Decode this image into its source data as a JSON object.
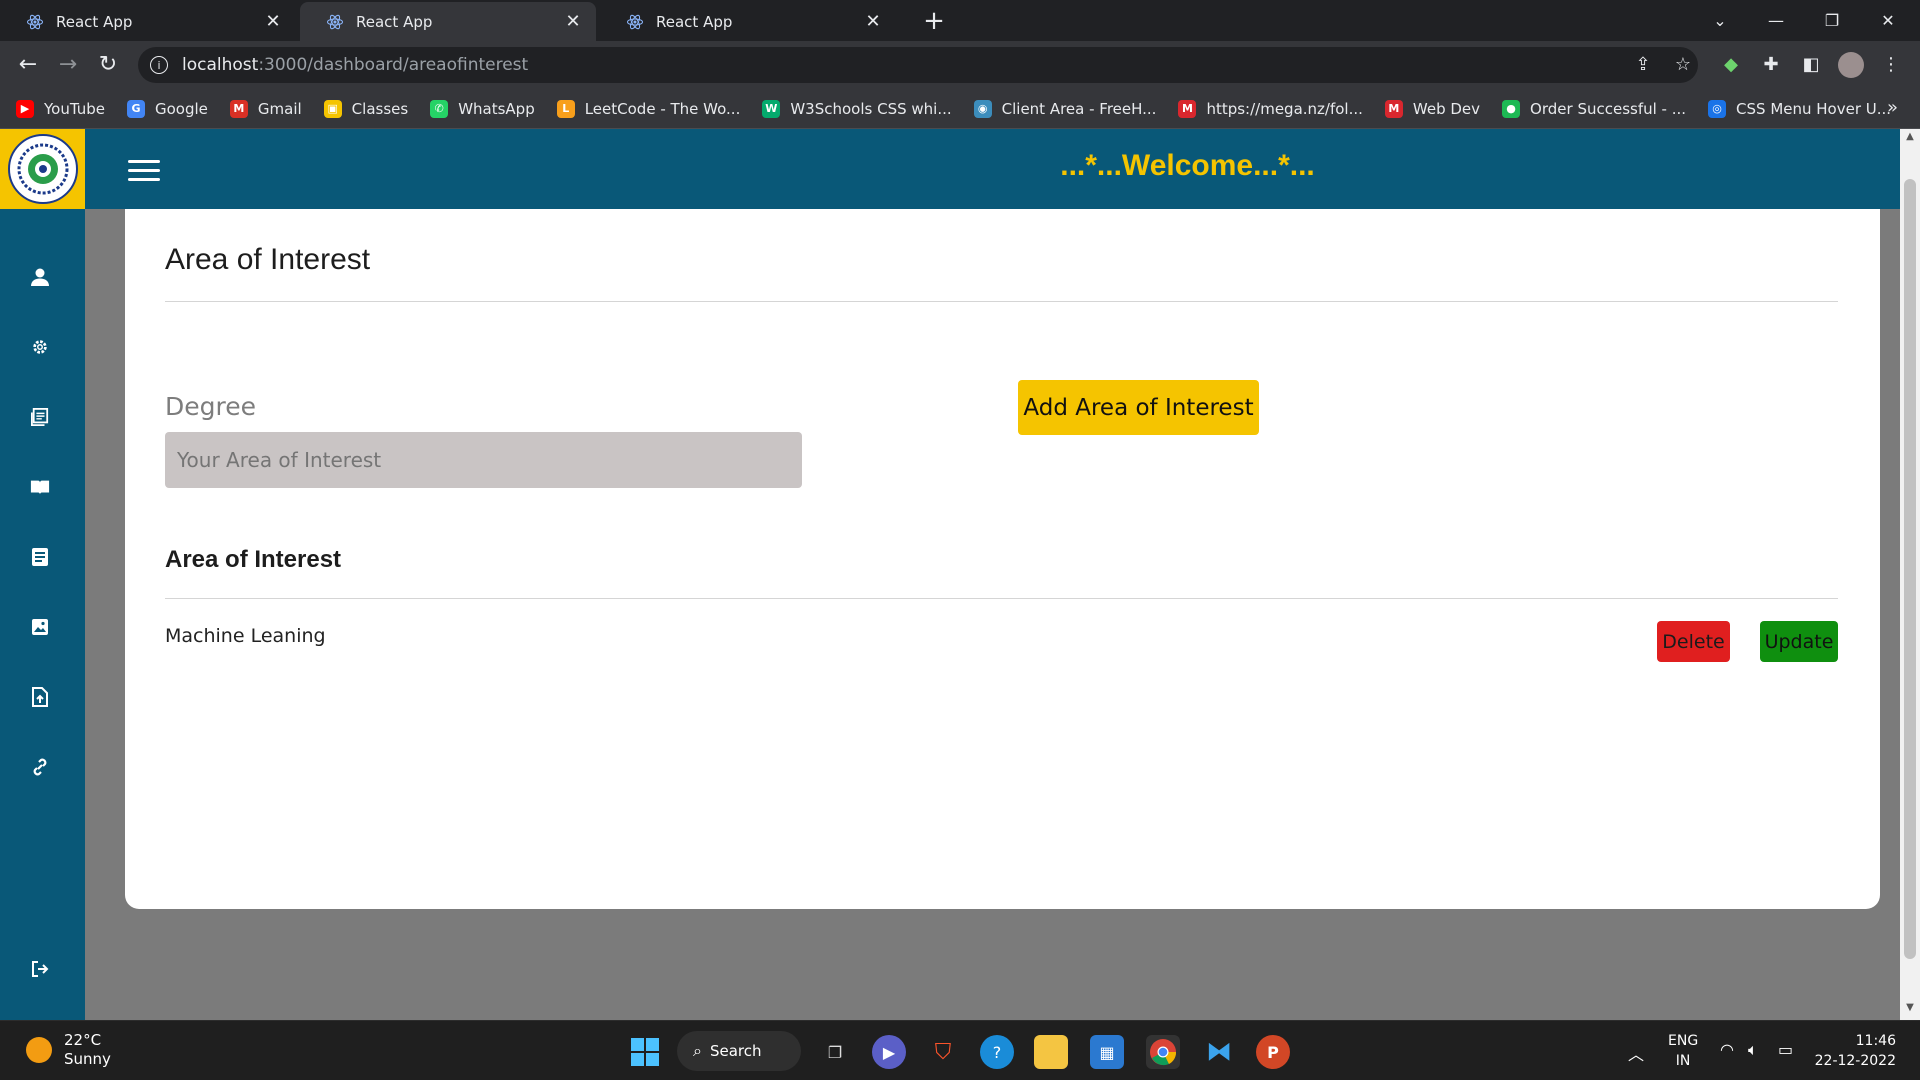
{
  "browser": {
    "tabs": [
      {
        "title": "React App",
        "active": false
      },
      {
        "title": "React App",
        "active": true
      },
      {
        "title": "React App",
        "active": false
      }
    ],
    "url_host": "localhost",
    "url_path": ":3000/dashboard/areaofinterest",
    "bookmarks": [
      {
        "label": "YouTube",
        "icon": "youtube-icon",
        "color": "#ff0000",
        "glyph": "▶"
      },
      {
        "label": "Google",
        "icon": "google-icon",
        "color": "#4285f4",
        "glyph": "G"
      },
      {
        "label": "Gmail",
        "icon": "gmail-icon",
        "color": "#d93025",
        "glyph": "M"
      },
      {
        "label": "Classes",
        "icon": "classes-icon",
        "color": "#f5c400",
        "glyph": "▣"
      },
      {
        "label": "WhatsApp",
        "icon": "whatsapp-icon",
        "color": "#25d366",
        "glyph": "✆"
      },
      {
        "label": "LeetCode - The Wo...",
        "icon": "leetcode-icon",
        "color": "#f89f1b",
        "glyph": "L"
      },
      {
        "label": "W3Schools CSS whi...",
        "icon": "w3schools-icon",
        "color": "#04aa6d",
        "glyph": "W"
      },
      {
        "label": "Client Area - FreeH...",
        "icon": "freehosting-icon",
        "color": "#3c8dbc",
        "glyph": "◉"
      },
      {
        "label": "https://mega.nz/fol...",
        "icon": "mega-icon",
        "color": "#d9272e",
        "glyph": "M"
      },
      {
        "label": "Web Dev",
        "icon": "mega-icon",
        "color": "#d9272e",
        "glyph": "M"
      },
      {
        "label": "Order Successful - ...",
        "icon": "status-dot-icon",
        "color": "#1db954",
        "glyph": "●"
      },
      {
        "label": "CSS Menu Hover U...",
        "icon": "bookmark-page-icon",
        "color": "#1a73e8",
        "glyph": "◎"
      }
    ]
  },
  "header": {
    "welcome": "...*...Welcome...*..."
  },
  "sidebar": {
    "items": [
      {
        "icon": "user-icon"
      },
      {
        "icon": "gear-icon"
      },
      {
        "icon": "document-list-icon"
      },
      {
        "icon": "book-icon"
      },
      {
        "icon": "note-icon"
      },
      {
        "icon": "image-icon"
      },
      {
        "icon": "file-upload-icon"
      },
      {
        "icon": "link-icon"
      },
      {
        "icon": "logout-icon"
      }
    ]
  },
  "main": {
    "title": "Area of Interest",
    "field_label": "Degree",
    "input_value": "",
    "input_placeholder": "Your Area of Interest",
    "add_button": "Add Area of Interest",
    "list_title": "Area of Interest",
    "items": [
      {
        "name": "Machine Leaning",
        "delete_label": "Delete",
        "update_label": "Update"
      }
    ]
  },
  "taskbar": {
    "weather_temp": "22°C",
    "weather_desc": "Sunny",
    "search_label": "Search",
    "lang_top": "ENG",
    "lang_bottom": "IN",
    "time": "11:46",
    "date": "22-12-2022"
  },
  "colors": {
    "header_bg": "#095878",
    "accent_yellow": "#f5c400",
    "delete_red": "#e01f1f",
    "update_green": "#0f8f0f"
  }
}
